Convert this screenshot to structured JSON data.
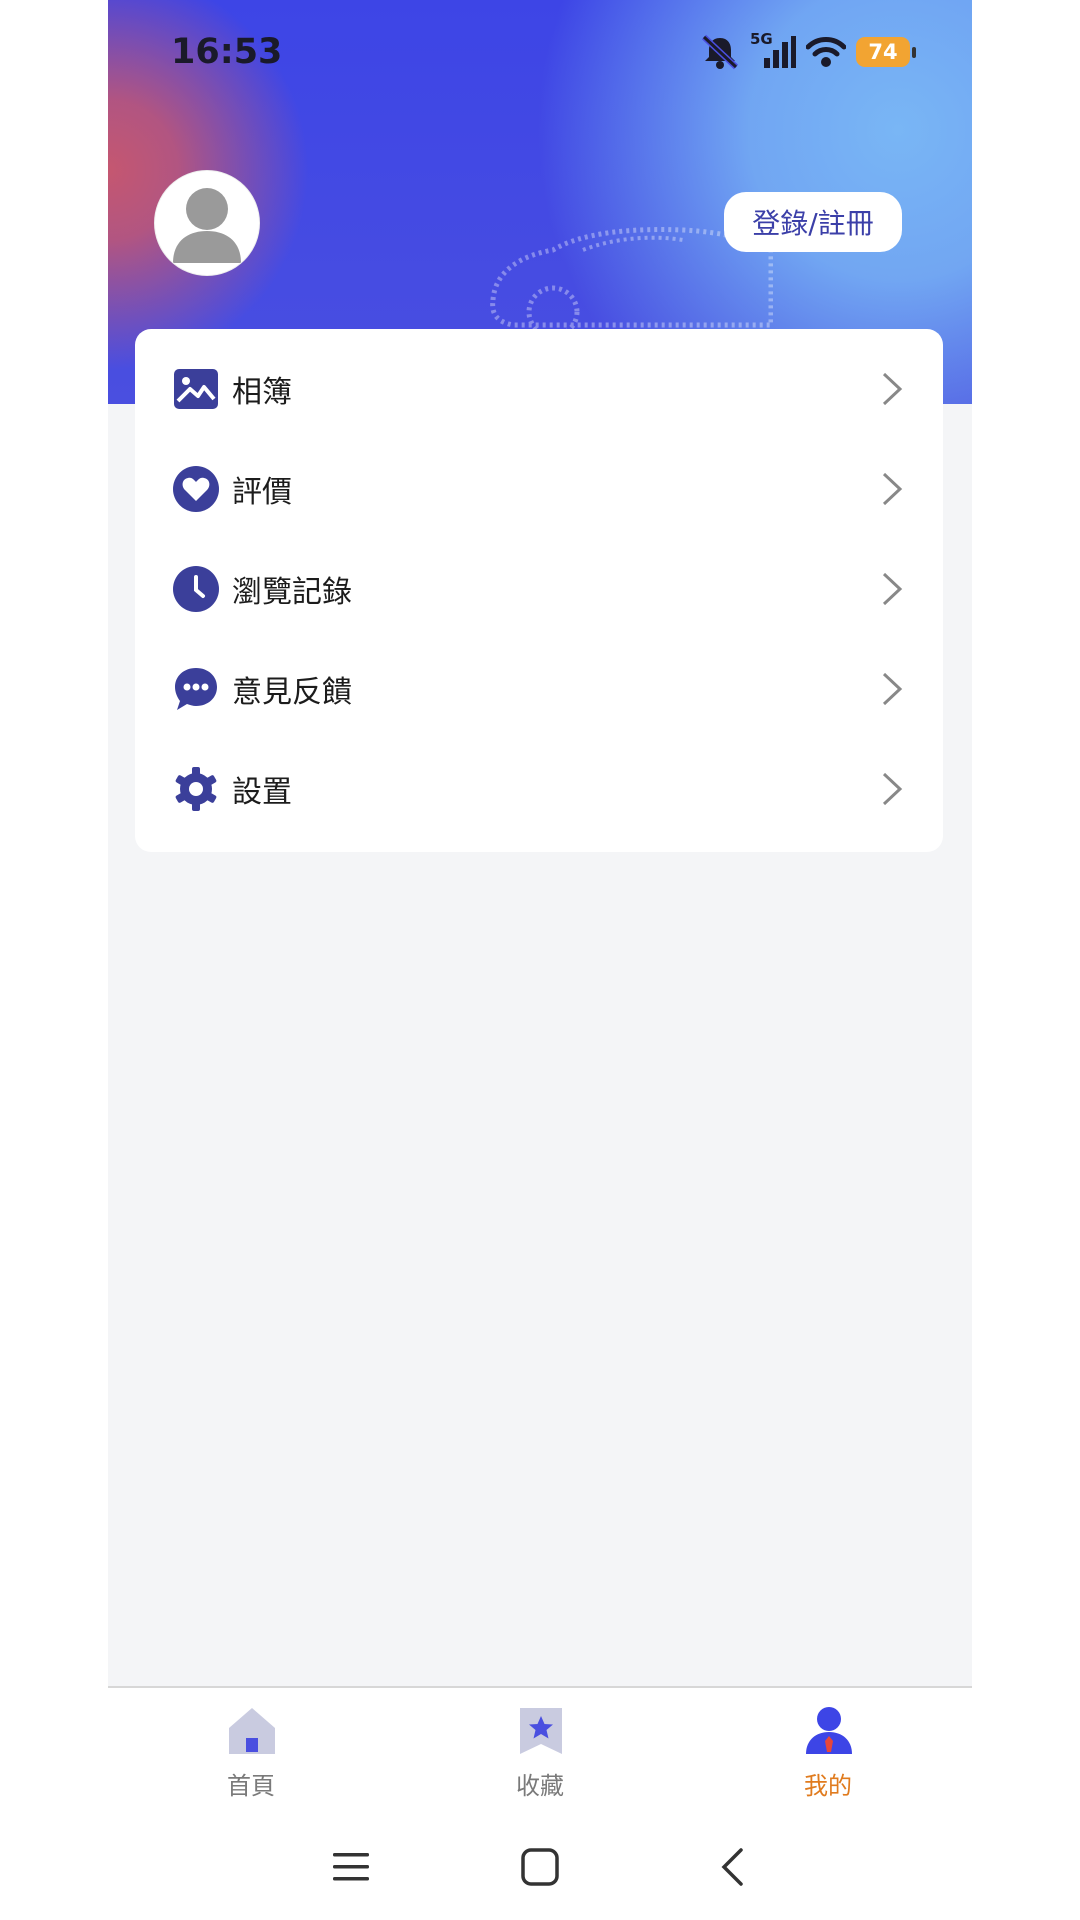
{
  "status_bar": {
    "time": "16:53",
    "network": "5G",
    "battery": "74",
    "icons": [
      "mute-bell-icon",
      "signal-icon",
      "wifi-icon",
      "battery-icon"
    ]
  },
  "profile": {
    "avatar_icon": "user-avatar-icon",
    "login_label": "登錄/註冊"
  },
  "menu": {
    "items": [
      {
        "label": "相簿",
        "icon": "photo-album-icon"
      },
      {
        "label": "評價",
        "icon": "heart-icon"
      },
      {
        "label": "瀏覽記錄",
        "icon": "clock-icon"
      },
      {
        "label": "意見反饋",
        "icon": "chat-bubble-icon"
      },
      {
        "label": "設置",
        "icon": "gear-icon"
      }
    ]
  },
  "tabbar": {
    "items": [
      {
        "label": "首頁",
        "icon": "home-icon",
        "active": false
      },
      {
        "label": "收藏",
        "icon": "bookmark-star-icon",
        "active": false
      },
      {
        "label": "我的",
        "icon": "profile-icon",
        "active": true
      }
    ]
  },
  "colors": {
    "brand": "#3d45e6",
    "accent_icon": "#3b3f9a",
    "active_tab": "#e07b1e",
    "inactive_tab": "#7a7a7a"
  }
}
